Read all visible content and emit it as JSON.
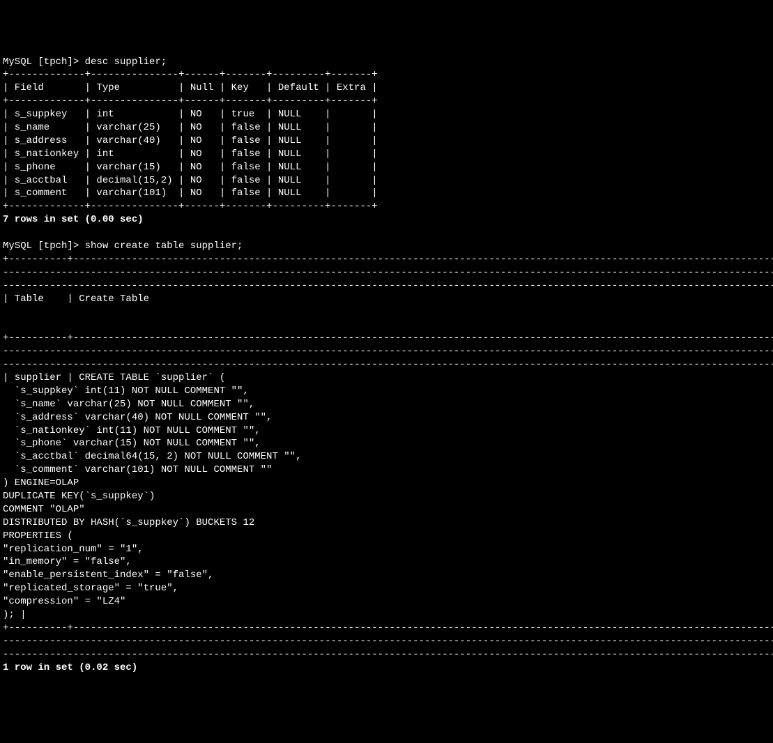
{
  "prompt1": "MySQL [tpch]> ",
  "command1": "desc supplier;",
  "table1": {
    "border_top": "+-------------+---------------+------+-------+---------+-------+",
    "header_row": "| Field       | Type          | Null | Key   | Default | Extra |",
    "border_mid": "+-------------+---------------+------+-------+---------+-------+",
    "rows": [
      "| s_suppkey   | int           | NO   | true  | NULL    |       |",
      "| s_name      | varchar(25)   | NO   | false | NULL    |       |",
      "| s_address   | varchar(40)   | NO   | false | NULL    |       |",
      "| s_nationkey | int           | NO   | false | NULL    |       |",
      "| s_phone     | varchar(15)   | NO   | false | NULL    |       |",
      "| s_acctbal   | decimal(15,2) | NO   | false | NULL    |       |",
      "| s_comment   | varchar(101)  | NO   | false | NULL    |       |"
    ],
    "border_bot": "+-------------+---------------+------+-------+---------+-------+"
  },
  "result1": "7 rows in set (0.00 sec)",
  "blank": "",
  "prompt2": "MySQL [tpch]> ",
  "command2": "show create table supplier;",
  "table2": {
    "border1": "+----------+-----------------------------------------------------------------------------------------------------------------------------------------------",
    "border1b": "--------------------------------------------------------------------------------------------------------------------------------------------------------------",
    "border1c": "-----------------------------------------------------------------------------------------------------------------------------------------+",
    "header": "| Table    | Create Table                                                                                                                                  ",
    "header_b": "                                                                                                                                                              ",
    "header_c": "                                                                                                                                         |",
    "border2": "+----------+-----------------------------------------------------------------------------------------------------------------------------------------------",
    "border2b": "--------------------------------------------------------------------------------------------------------------------------------------------------------------",
    "border2c": "-----------------------------------------------------------------------------------------------------------------------------------------+",
    "content": [
      "| supplier | CREATE TABLE `supplier` (",
      "  `s_suppkey` int(11) NOT NULL COMMENT \"\",",
      "  `s_name` varchar(25) NOT NULL COMMENT \"\",",
      "  `s_address` varchar(40) NOT NULL COMMENT \"\",",
      "  `s_nationkey` int(11) NOT NULL COMMENT \"\",",
      "  `s_phone` varchar(15) NOT NULL COMMENT \"\",",
      "  `s_acctbal` decimal64(15, 2) NOT NULL COMMENT \"\",",
      "  `s_comment` varchar(101) NOT NULL COMMENT \"\"",
      ") ENGINE=OLAP",
      "DUPLICATE KEY(`s_suppkey`)",
      "COMMENT \"OLAP\"",
      "DISTRIBUTED BY HASH(`s_suppkey`) BUCKETS 12",
      "PROPERTIES (",
      "\"replication_num\" = \"1\",",
      "\"in_memory\" = \"false\",",
      "\"enable_persistent_index\" = \"false\",",
      "\"replicated_storage\" = \"true\",",
      "\"compression\" = \"LZ4\"",
      "); |"
    ],
    "border3": "+----------+-----------------------------------------------------------------------------------------------------------------------------------------------",
    "border3b": "--------------------------------------------------------------------------------------------------------------------------------------------------------------",
    "border3c": "-----------------------------------------------------------------------------------------------------------------------------------------+"
  },
  "result2": "1 row in set (0.02 sec)"
}
